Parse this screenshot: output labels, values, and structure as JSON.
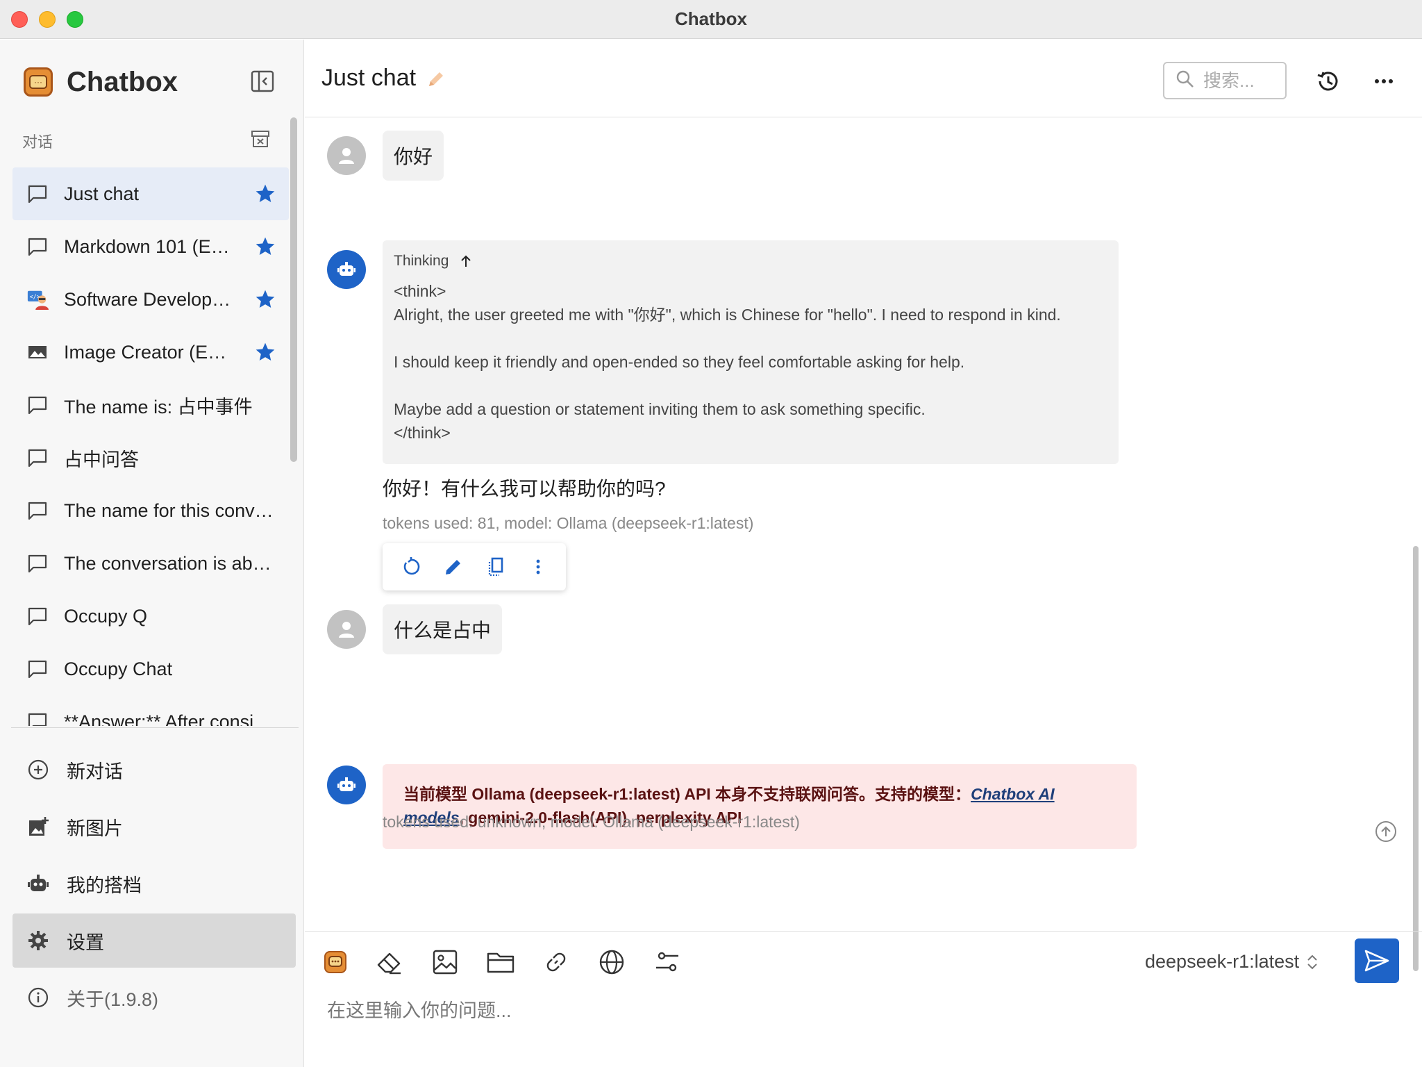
{
  "window": {
    "title": "Chatbox"
  },
  "sidebar": {
    "brand": "Chatbox",
    "section_label": "对话",
    "conversations": [
      {
        "label": "Just chat",
        "starred": true,
        "icon": "chat-bubble-icon",
        "active": true
      },
      {
        "label": "Markdown 101 (E…",
        "starred": true,
        "icon": "chat-bubble-icon"
      },
      {
        "label": "Software Develop…",
        "starred": true,
        "icon": "developer-avatar-icon"
      },
      {
        "label": "Image Creator (E…",
        "starred": true,
        "icon": "image-icon"
      },
      {
        "label": "The name is: 占中事件",
        "starred": false,
        "icon": "chat-bubble-icon"
      },
      {
        "label": "占中问答",
        "starred": false,
        "icon": "chat-bubble-icon"
      },
      {
        "label": "The name for this conv…",
        "starred": false,
        "icon": "chat-bubble-icon"
      },
      {
        "label": "The conversation is ab…",
        "starred": false,
        "icon": "chat-bubble-icon"
      },
      {
        "label": "Occupy Q",
        "starred": false,
        "icon": "chat-bubble-icon"
      },
      {
        "label": "Occupy Chat",
        "starred": false,
        "icon": "chat-bubble-icon"
      },
      {
        "label": "**Answer:** After consi…",
        "starred": false,
        "icon": "chat-bubble-icon"
      }
    ],
    "menu": {
      "new_chat": "新对话",
      "new_image": "新图片",
      "my_copilots": "我的搭档",
      "settings": "设置",
      "about": "关于(1.9.8)"
    }
  },
  "header": {
    "chat_title": "Just chat",
    "search_placeholder": "搜索..."
  },
  "messages": {
    "user1": "你好",
    "thinking_label": "Thinking",
    "think_lines": {
      "open": "<think>",
      "l1": "Alright, the user greeted me with \"你好\", which is Chinese for \"hello\". I need to respond in kind.",
      "l2": "I should keep it friendly and open-ended so they feel comfortable asking for help.",
      "l3": "Maybe add a question or statement inviting them to ask something specific.",
      "close": "</think>"
    },
    "answer1": "你好！有什么我可以帮助你的吗?",
    "tokens1": "tokens used: 81, model: Ollama (deepseek-r1:latest)",
    "user2": "什么是占中",
    "error": {
      "prefix": "当前模型 Ollama (deepseek-r1:latest) API 本身不支持联网问答。支持的模型：",
      "link": "Chatbox AI models",
      "suffix": ", gemini-2.0-flash(API), perplexity API"
    },
    "tokens2": "tokens used: unknown, model: Ollama (deepseek-r1:latest)"
  },
  "composer": {
    "model": "deepseek-r1:latest",
    "placeholder": "在这里输入你的问题..."
  },
  "colors": {
    "accent": "#1e63c7",
    "star": "#1e63c7",
    "error_bg": "#fde7e7",
    "active_conv_bg": "#e6ecf7"
  }
}
